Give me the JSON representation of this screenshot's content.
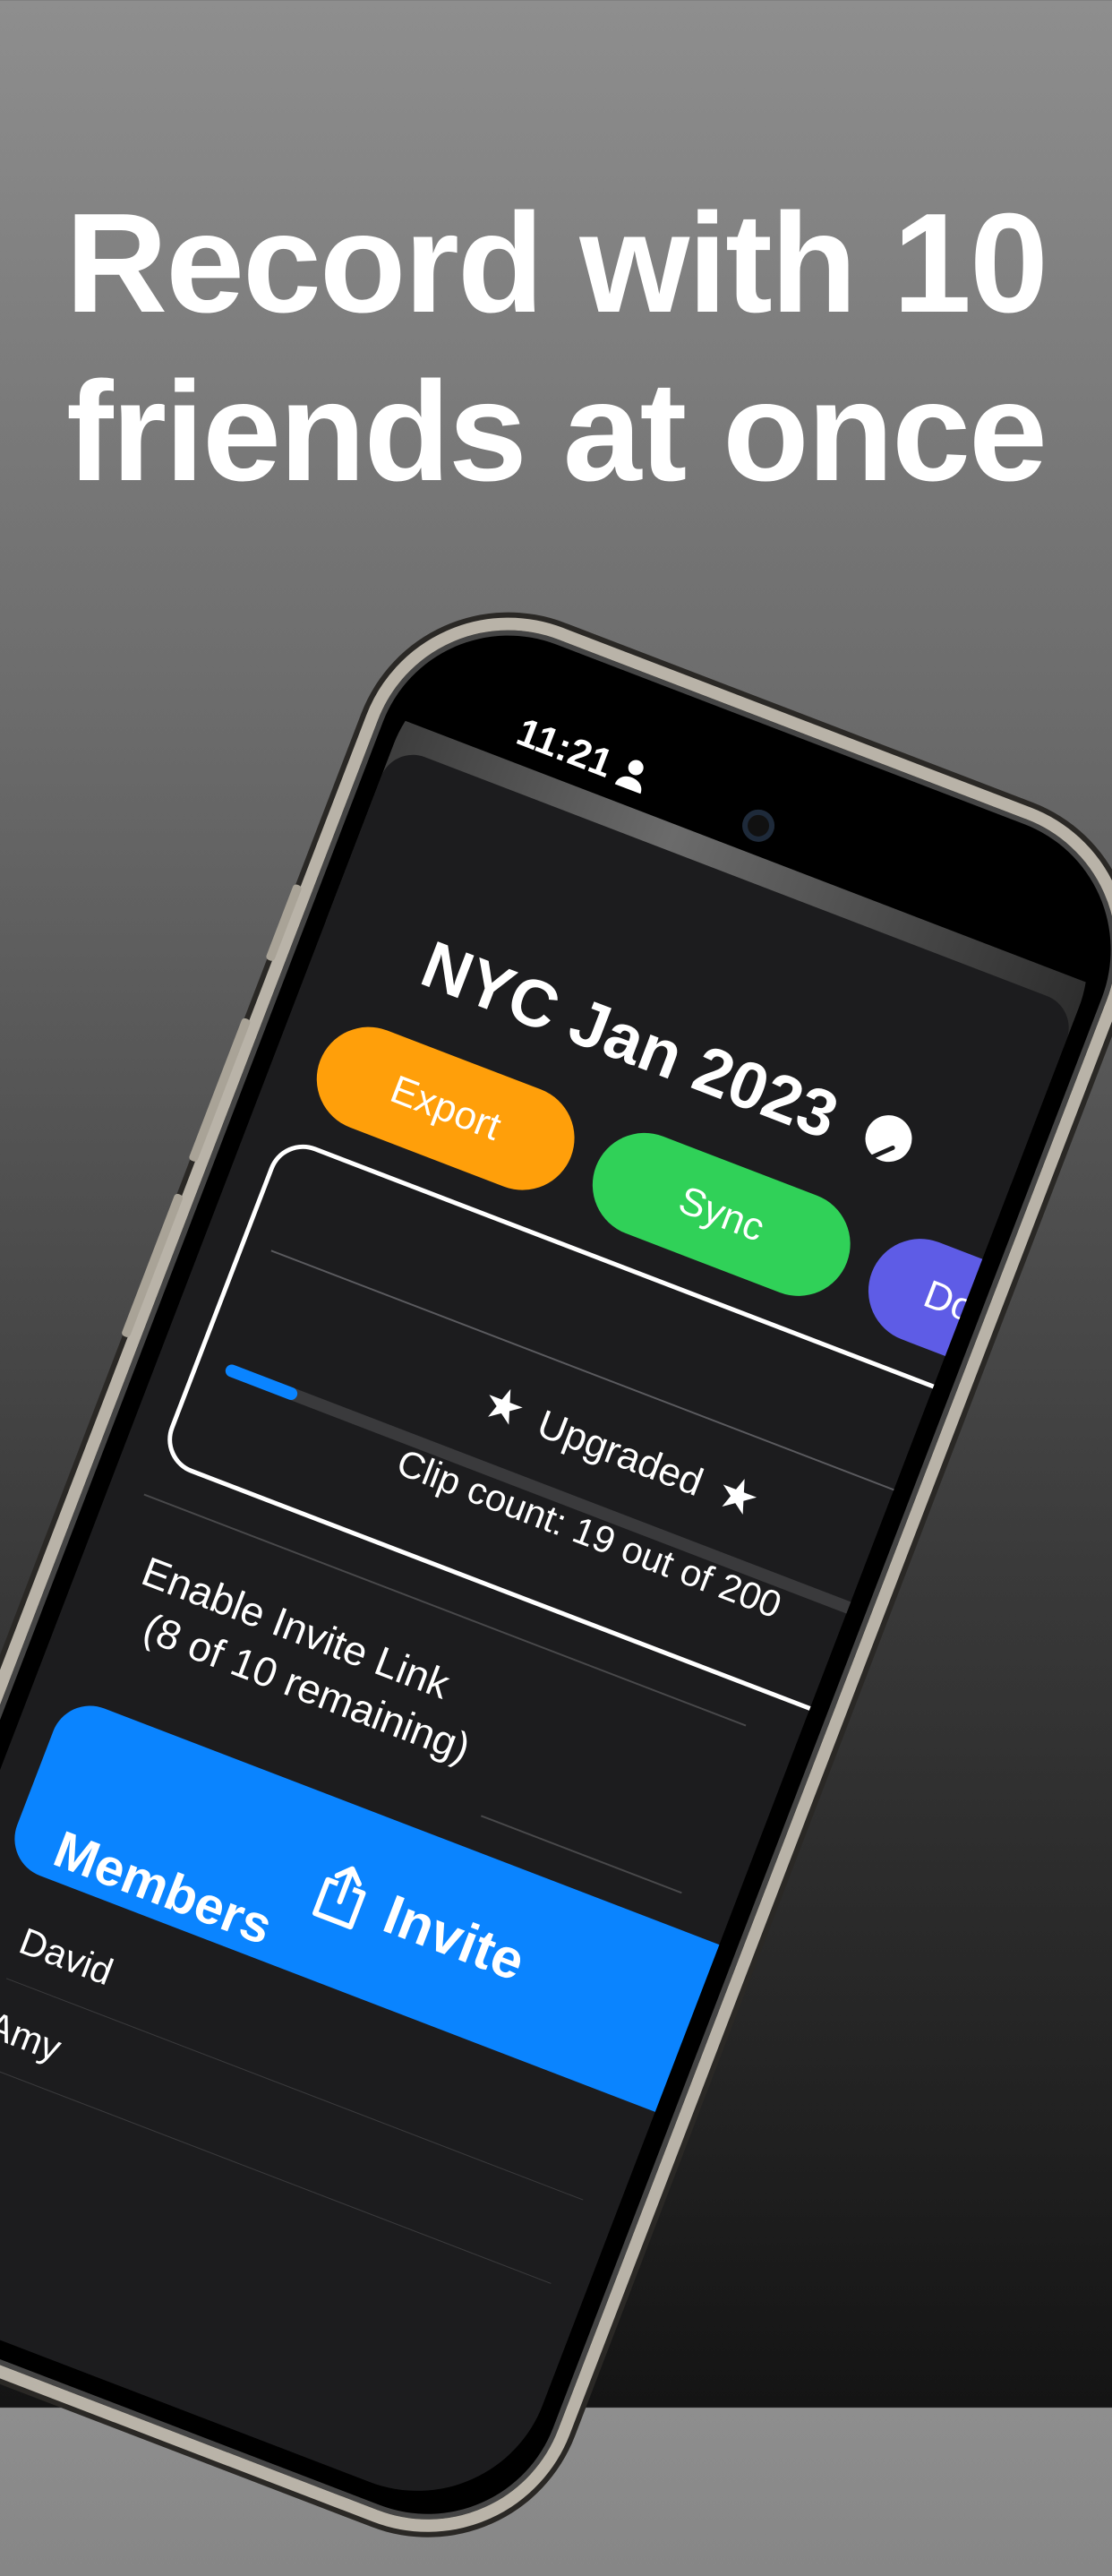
{
  "headline": {
    "line1": "Record with 10",
    "line2": "friends at once"
  },
  "status_bar": {
    "time": "11:21"
  },
  "session": {
    "title": "NYC Jan 2023"
  },
  "actions": {
    "export": "Export",
    "sync": "Sync",
    "download": "Downloa"
  },
  "plan": {
    "badge": "Upgraded",
    "clip_count_text": "Clip count: 19 out of 200",
    "clips_used": 19,
    "clips_total": 200
  },
  "invite_link": {
    "label": "Enable Invite Link",
    "remaining": "(8 of 10 remaining)",
    "enabled": true
  },
  "invite_button": {
    "label": "Invite"
  },
  "members": {
    "heading": "Members",
    "items": [
      "David",
      "Amy"
    ]
  },
  "colors": {
    "export": "#ff9f0a",
    "sync": "#30d158",
    "download": "#5e5ce6",
    "accent": "#0a84ff",
    "sheet": "#1c1c1e"
  }
}
